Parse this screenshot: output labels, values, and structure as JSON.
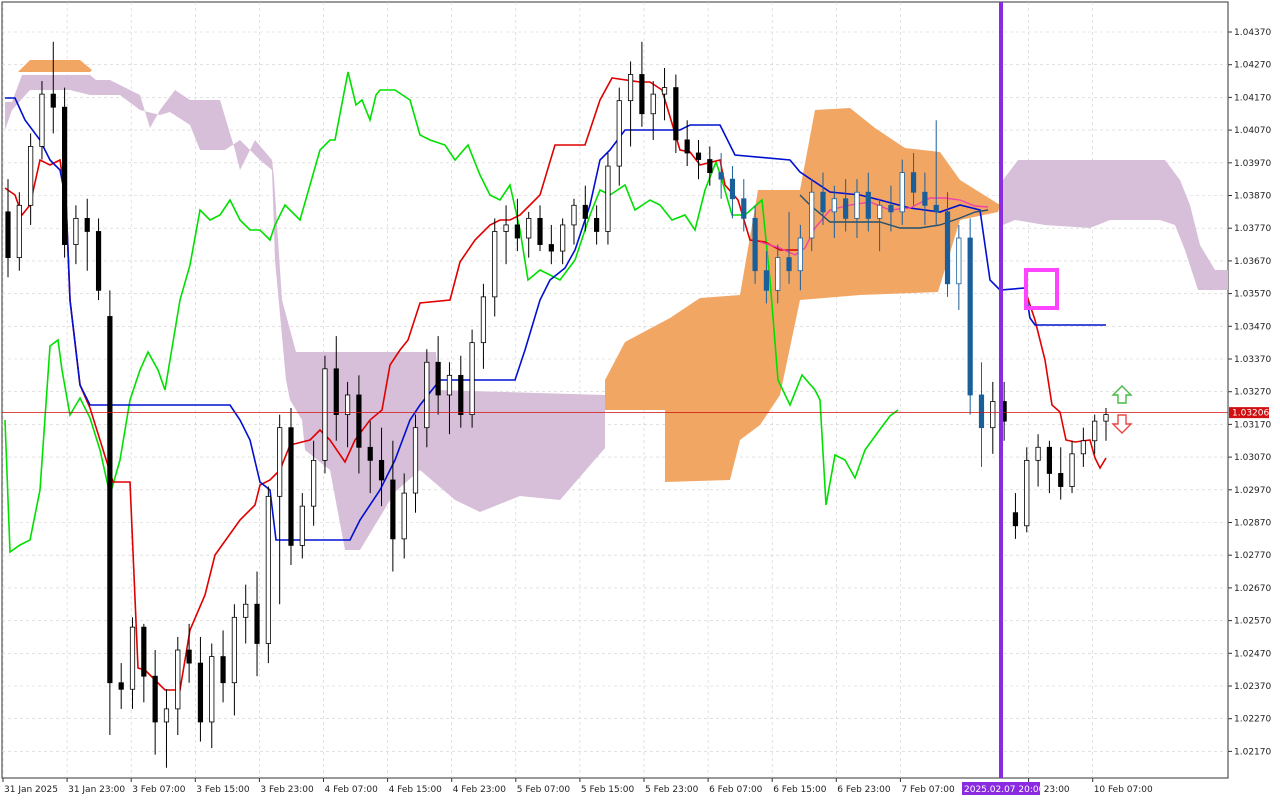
{
  "chart_data": {
    "type": "candlestick",
    "title": "",
    "indicator": "Ichimoku Kinko Hyo",
    "ylim": [
      1.0212,
      1.0442
    ],
    "y_ticks": [
      "1.04370",
      "1.04270",
      "1.04170",
      "1.04070",
      "1.03970",
      "1.03870",
      "1.03770",
      "1.03670",
      "1.03570",
      "1.03470",
      "1.03370",
      "1.03270",
      "1.03170",
      "1.03070",
      "1.02970",
      "1.02870",
      "1.02770",
      "1.02670",
      "1.02570",
      "1.02470",
      "1.02370",
      "1.02270",
      "1.02170"
    ],
    "x_ticks": [
      "31 Jan 2025",
      "31 Jan 23:00",
      "3 Feb 07:00",
      "3 Feb 15:00",
      "3 Feb 23:00",
      "4 Feb 07:00",
      "4 Feb 15:00",
      "4 Feb 23:00",
      "5 Feb 07:00",
      "5 Feb 15:00",
      "5 Feb 23:00",
      "6 Feb 07:00",
      "6 Feb 15:00",
      "6 Feb 23:00",
      "7 Feb 07:00",
      "2025.02.07 20:00",
      "eb 23:00",
      "10 Feb 07:00"
    ],
    "current_price": "1.03206",
    "cursor_label": "2025.02.07 20:00",
    "colors": {
      "tenkan": "#e00000",
      "kijun": "#0010d0",
      "chikou": "#00e000",
      "cloud_bear": "#d7bfd9",
      "cloud_bull": "#f2a664",
      "cursor": "#8a2be2",
      "price_line": "#d01010",
      "highlight": "#ff44ff",
      "small_line": "#ee44aa",
      "small_kijun": "#205070"
    },
    "candles": [
      [
        1.0382,
        1.0392,
        1.0362,
        1.0368
      ],
      [
        1.0368,
        1.0388,
        1.0364,
        1.0384
      ],
      [
        1.0384,
        1.0406,
        1.0378,
        1.0402
      ],
      [
        1.0402,
        1.0422,
        1.0398,
        1.0418
      ],
      [
        1.0418,
        1.0434,
        1.0406,
        1.0414
      ],
      [
        1.0414,
        1.042,
        1.0368,
        1.0372
      ],
      [
        1.0372,
        1.0384,
        1.0366,
        1.038
      ],
      [
        1.038,
        1.0386,
        1.0364,
        1.0376
      ],
      [
        1.0376,
        1.038,
        1.0355,
        1.0358
      ],
      [
        1.035,
        1.0358,
        1.0222,
        1.0238
      ],
      [
        1.0238,
        1.0244,
        1.023,
        1.0236
      ],
      [
        1.0236,
        1.0258,
        1.023,
        1.0255
      ],
      [
        1.0255,
        1.0256,
        1.0232,
        1.024
      ],
      [
        1.024,
        1.0248,
        1.0216,
        1.0226
      ],
      [
        1.0226,
        1.0236,
        1.0212,
        1.023
      ],
      [
        1.023,
        1.0252,
        1.0222,
        1.0248
      ],
      [
        1.0248,
        1.0256,
        1.0238,
        1.0244
      ],
      [
        1.0244,
        1.0252,
        1.022,
        1.0226
      ],
      [
        1.0226,
        1.025,
        1.0218,
        1.0246
      ],
      [
        1.0246,
        1.0254,
        1.0232,
        1.0238
      ],
      [
        1.0238,
        1.0262,
        1.0228,
        1.0258
      ],
      [
        1.0258,
        1.0268,
        1.025,
        1.0262
      ],
      [
        1.0262,
        1.0272,
        1.024,
        1.025
      ],
      [
        1.025,
        1.0298,
        1.0244,
        1.0295
      ],
      [
        1.0295,
        1.032,
        1.0262,
        1.0316
      ],
      [
        1.0316,
        1.0322,
        1.0274,
        1.028
      ],
      [
        1.028,
        1.0296,
        1.0276,
        1.0292
      ],
      [
        1.0292,
        1.0312,
        1.0286,
        1.0306
      ],
      [
        1.0306,
        1.0338,
        1.0302,
        1.0334
      ],
      [
        1.0334,
        1.0344,
        1.0312,
        1.032
      ],
      [
        1.032,
        1.033,
        1.031,
        1.0326
      ],
      [
        1.0326,
        1.0332,
        1.0302,
        1.031
      ],
      [
        1.031,
        1.0318,
        1.0296,
        1.0306
      ],
      [
        1.0306,
        1.0316,
        1.0292,
        1.03
      ],
      [
        1.03,
        1.0312,
        1.0272,
        1.0282
      ],
      [
        1.0282,
        1.0302,
        1.0276,
        1.0296
      ],
      [
        1.0296,
        1.032,
        1.029,
        1.0316
      ],
      [
        1.0316,
        1.034,
        1.031,
        1.0336
      ],
      [
        1.0336,
        1.0344,
        1.032,
        1.0326
      ],
      [
        1.0326,
        1.0336,
        1.0314,
        1.0332
      ],
      [
        1.0332,
        1.0338,
        1.0316,
        1.032
      ],
      [
        1.032,
        1.0346,
        1.0316,
        1.0342
      ],
      [
        1.0342,
        1.036,
        1.0334,
        1.0356
      ],
      [
        1.0356,
        1.038,
        1.035,
        1.0376
      ],
      [
        1.0376,
        1.0384,
        1.0366,
        1.0378
      ],
      [
        1.0378,
        1.0386,
        1.037,
        1.0374
      ],
      [
        1.0374,
        1.0382,
        1.0368,
        1.038
      ],
      [
        1.038,
        1.0384,
        1.037,
        1.0372
      ],
      [
        1.0372,
        1.0378,
        1.0366,
        1.037
      ],
      [
        1.037,
        1.038,
        1.0366,
        1.0378
      ],
      [
        1.0378,
        1.0386,
        1.0372,
        1.0384
      ],
      [
        1.0384,
        1.039,
        1.0376,
        1.038
      ],
      [
        1.038,
        1.0384,
        1.0372,
        1.0376
      ],
      [
        1.0376,
        1.04,
        1.0372,
        1.0396
      ],
      [
        1.0396,
        1.042,
        1.039,
        1.0416
      ],
      [
        1.0416,
        1.0428,
        1.0402,
        1.0424
      ],
      [
        1.0424,
        1.0434,
        1.0408,
        1.0412
      ],
      [
        1.0412,
        1.0422,
        1.0404,
        1.0418
      ],
      [
        1.0418,
        1.0426,
        1.041,
        1.042
      ],
      [
        1.042,
        1.0424,
        1.04,
        1.0404
      ],
      [
        1.0404,
        1.041,
        1.0396,
        1.04
      ],
      [
        1.04,
        1.0404,
        1.0392,
        1.0398
      ],
      [
        1.0398,
        1.0402,
        1.039,
        1.0394
      ],
      [
        1.0394,
        1.04,
        1.0386,
        1.0392
      ],
      [
        1.0392,
        1.0396,
        1.038,
        1.0386
      ],
      [
        1.0386,
        1.0392,
        1.0376,
        1.038
      ],
      [
        1.038,
        1.0384,
        1.036,
        1.0364
      ],
      [
        1.0364,
        1.037,
        1.0354,
        1.0358
      ],
      [
        1.0358,
        1.0372,
        1.0354,
        1.0368
      ],
      [
        1.0368,
        1.0382,
        1.036,
        1.0364
      ],
      [
        1.0364,
        1.0378,
        1.0358,
        1.0374
      ],
      [
        1.0374,
        1.0392,
        1.037,
        1.0388
      ],
      [
        1.0388,
        1.0394,
        1.0378,
        1.0382
      ],
      [
        1.0382,
        1.039,
        1.0374,
        1.0386
      ],
      [
        1.0386,
        1.0392,
        1.0376,
        1.038
      ],
      [
        1.038,
        1.0392,
        1.0374,
        1.0388
      ],
      [
        1.0388,
        1.0394,
        1.0376,
        1.038
      ],
      [
        1.038,
        1.0386,
        1.037,
        1.0384
      ],
      [
        1.0384,
        1.039,
        1.0376,
        1.0382
      ],
      [
        1.0382,
        1.0398,
        1.0378,
        1.0394
      ],
      [
        1.0394,
        1.04,
        1.0384,
        1.0388
      ],
      [
        1.0388,
        1.0394,
        1.0378,
        1.0384
      ],
      [
        1.0384,
        1.041,
        1.0378,
        1.0382
      ],
      [
        1.0382,
        1.0388,
        1.0356,
        1.036
      ],
      [
        1.036,
        1.0378,
        1.0352,
        1.0374
      ],
      [
        1.0374,
        1.038,
        1.032,
        1.0326
      ],
      [
        1.0326,
        1.0336,
        1.0304,
        1.0316
      ],
      [
        1.0316,
        1.033,
        1.0308,
        1.0324
      ],
      [
        1.0324,
        1.033,
        1.0312,
        1.0318
      ],
      [
        1.029,
        1.0296,
        1.0282,
        1.0286
      ],
      [
        1.0286,
        1.031,
        1.0284,
        1.0306
      ],
      [
        1.0306,
        1.0314,
        1.0298,
        1.031
      ],
      [
        1.031,
        1.0312,
        1.0296,
        1.0302
      ],
      [
        1.0302,
        1.031,
        1.0294,
        1.0298
      ],
      [
        1.0298,
        1.0312,
        1.0296,
        1.0308
      ],
      [
        1.0308,
        1.0316,
        1.0304,
        1.0312
      ],
      [
        1.0312,
        1.032,
        1.0308,
        1.0318
      ],
      [
        1.0318,
        1.0322,
        1.0312,
        1.032
      ]
    ]
  }
}
